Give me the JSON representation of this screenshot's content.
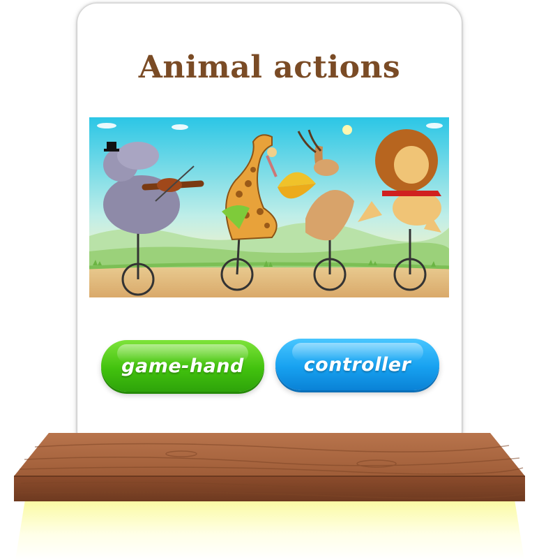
{
  "title": "Animal actions",
  "scene": {
    "description_icon": "animals-on-unicycles-illustration",
    "animals": [
      "hippo-violin",
      "giraffe-icecream",
      "gazelle-umbrella",
      "lion-scarf"
    ]
  },
  "buttons": {
    "game_hand": "game-hand",
    "controller": "controller"
  },
  "colors": {
    "title": "#7a4b25",
    "green_button": "#42c20e",
    "blue_button": "#17a1f0",
    "shelf_wood": "#a8653f"
  }
}
